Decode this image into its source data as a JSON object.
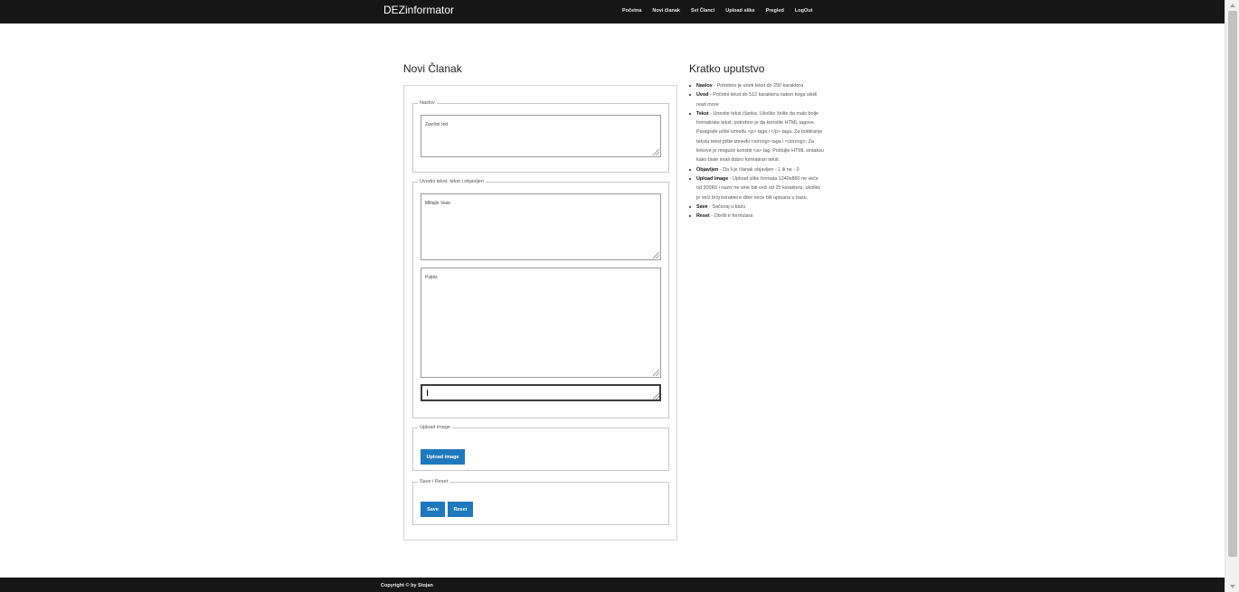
{
  "navbar": {
    "brand": "DEZinformator",
    "links": [
      "Početna",
      "Novi članak",
      "Svi Članci",
      "Upload slike",
      "Pregled",
      "LogOut"
    ]
  },
  "form": {
    "heading": "Novi Članak",
    "naslov": {
      "legend": "Naslov",
      "value": "Završni red"
    },
    "uvod": {
      "legend": "Uvodni tekst, tekst i objavljen",
      "intro_value": "Miltajlo Vasic",
      "text_value": "Pulpis",
      "published_value": ""
    },
    "upload": {
      "legend": "Upload image",
      "button": "Upload image"
    },
    "actions": {
      "legend": "Save i Reset",
      "save": "Save",
      "reset": "Reset"
    }
  },
  "help": {
    "heading": "Kratko uputstvo",
    "items": [
      {
        "term": "Naslov",
        "text": " - Potrebno je uneti tekst do 250 karaktera"
      },
      {
        "term": "Uvod",
        "text": " - Početni tekst do 512 karaktera nakon koga sledi read more"
      },
      {
        "term": "Tekst",
        "text": " - Unesite tekst članka. Ukoliko želite da malo bolje formatirate tekst, potrebno je da koristite HTML tagove. Paragrafe pište između <p> taga i </p> taga. Za boldiranje teksta tekst pište između <strong> taga i </strong>. Za linkove je moguće koristiti <a> tag. Poštujte HTML sintaksu kako biste imali dobro formatiran tekst."
      },
      {
        "term": "Objavljen",
        "text": " - Da li je članak objavljen - 1 ili ne - 0"
      },
      {
        "term": "Upload image",
        "text": " - Upload slike formata 1240x860 ne veće od 300Kb i naziv ne sme biti veći od 25 karaktera, ukoliko je veći broj karaktera slike neće biti upisana u bazu."
      },
      {
        "term": "Save",
        "text": " - Sačuvaj u bazu"
      },
      {
        "term": "Reset",
        "text": " - Obriši ir formulara"
      }
    ]
  },
  "footer": {
    "text": "Copyright © by Stojan"
  }
}
